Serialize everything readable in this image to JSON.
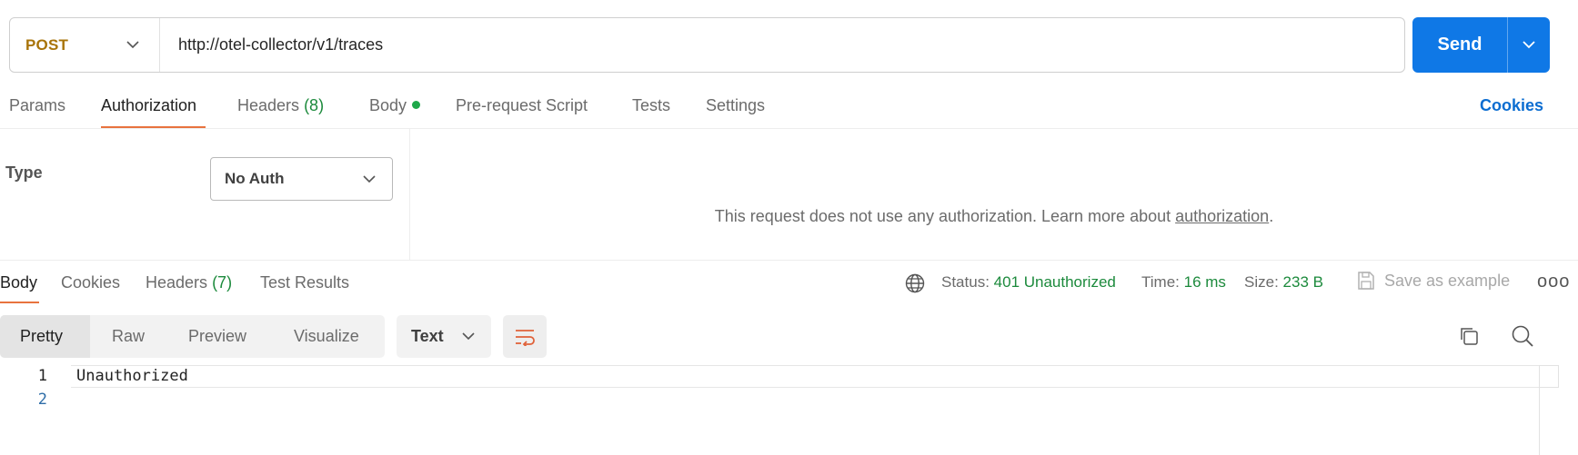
{
  "request": {
    "method": "POST",
    "url": "http://otel-collector/v1/traces",
    "send_label": "Send"
  },
  "request_tabs": {
    "params": "Params",
    "authorization": "Authorization",
    "headers": "Headers",
    "headers_count": "(8)",
    "body": "Body",
    "pre_request": "Pre-request Script",
    "tests": "Tests",
    "settings": "Settings",
    "cookies": "Cookies",
    "active": "Authorization"
  },
  "auth": {
    "type_label": "Type",
    "selected_type": "No Auth",
    "message_prefix": "This request does not use any authorization. Learn more about ",
    "message_link": "authorization",
    "message_suffix": "."
  },
  "response_tabs": {
    "body": "Body",
    "cookies": "Cookies",
    "headers": "Headers",
    "headers_count": "(7)",
    "test_results": "Test Results"
  },
  "response_status": {
    "status_label": "Status:",
    "status_value": "401 Unauthorized",
    "time_label": "Time:",
    "time_value": "16 ms",
    "size_label": "Size:",
    "size_value": "233 B",
    "save_example": "Save as example",
    "more": "ooo"
  },
  "format": {
    "views": [
      "Pretty",
      "Raw",
      "Preview",
      "Visualize"
    ],
    "active_view": "Pretty",
    "text_type": "Text"
  },
  "editor": {
    "lines": [
      {
        "num": "1",
        "text": "Unauthorized"
      },
      {
        "num": "2",
        "text": ""
      }
    ]
  },
  "colors": {
    "accent_blue": "#0f78e6",
    "method_post": "#a8740a",
    "tab_underline": "#e8733e",
    "success_green": "#1c8a3c"
  },
  "icons": {
    "method_caret": "chevron-down-icon",
    "send_caret": "chevron-down-icon",
    "globe": "globe-icon",
    "save": "save-icon",
    "wrap": "wrap-lines-icon",
    "copy": "copy-icon",
    "search": "search-icon"
  }
}
